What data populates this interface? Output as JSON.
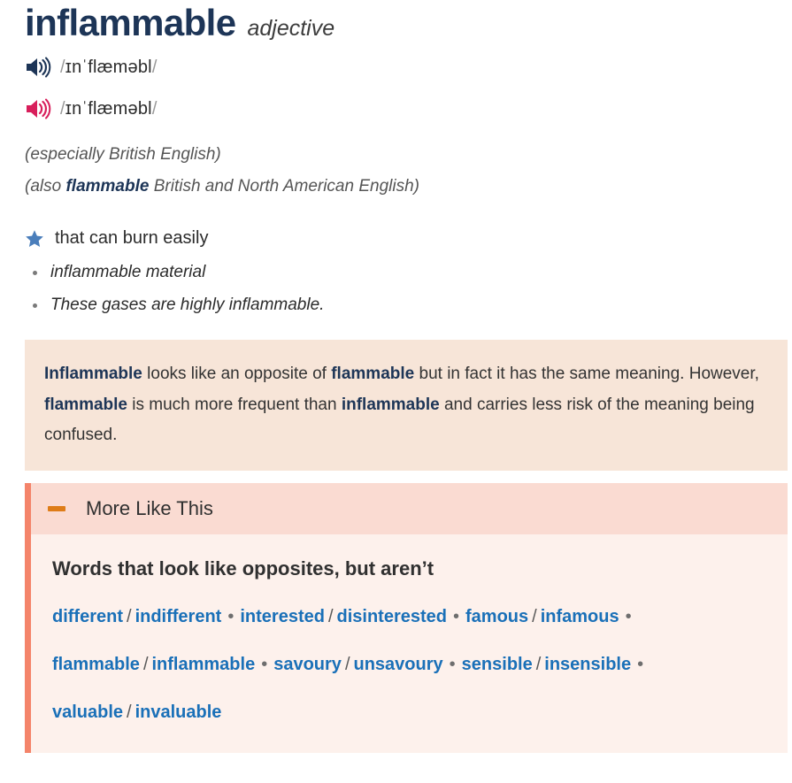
{
  "entry": {
    "headword": "inflammable",
    "part_of_speech": "adjective",
    "pronunciations": [
      {
        "accent": "british",
        "ipa": "ɪnˈflæməbl",
        "open_slash": "/",
        "close_slash": "/",
        "icon": "speaker-icon",
        "icon_color": "#1d3557"
      },
      {
        "accent": "american",
        "ipa": "ɪnˈflæməbl",
        "open_slash": "/",
        "close_slash": "/",
        "icon": "speaker-icon",
        "icon_color": "#d81e5b"
      }
    ],
    "variant_notes": [
      {
        "prefix": "(especially British English)",
        "alt_word": "",
        "suffix": ""
      },
      {
        "prefix": "(also ",
        "alt_word": "flammable",
        "suffix": " British and North American English)"
      }
    ],
    "sense": {
      "icon": "star-icon",
      "icon_color": "#4a7ebb",
      "definition": "that can burn easily",
      "examples": [
        "inflammable material",
        "These gases are highly inflammable."
      ]
    }
  },
  "usage_note": {
    "background": "#f7e5d8",
    "segments": [
      {
        "text": "Inflammable",
        "bold": true
      },
      {
        "text": " looks like an opposite of ",
        "bold": false
      },
      {
        "text": "flammable",
        "bold": true
      },
      {
        "text": " but in fact it has the same meaning. However, ",
        "bold": false
      },
      {
        "text": "flammable",
        "bold": true
      },
      {
        "text": " is much more frequent than ",
        "bold": false
      },
      {
        "text": "inflammable",
        "bold": true
      },
      {
        "text": " and carries less risk of the meaning being confused.",
        "bold": false
      }
    ]
  },
  "more_like_this": {
    "header_label": "More Like This",
    "toggle_icon": "minus-icon",
    "toggle_color": "#de7c18",
    "accent_color": "#f4846a",
    "header_background": "#fadbd2",
    "body_background": "#fdf1ec",
    "subtitle": "Words that look like opposites, but aren’t",
    "link_color": "#1a70b8",
    "separator_slash": "/",
    "separator_dot": "•",
    "rows": [
      {
        "pairs": [
          {
            "first": "different",
            "second": "indifferent"
          },
          {
            "first": "interested",
            "second": "disinterested"
          },
          {
            "first": "famous",
            "second": "infamous"
          }
        ],
        "trailing_dot": true
      },
      {
        "pairs": [
          {
            "first": "flammable",
            "second": "inflammable"
          },
          {
            "first": "savoury",
            "second": "unsavoury"
          },
          {
            "first": "sensible",
            "second": "insensible"
          }
        ],
        "trailing_dot": true
      },
      {
        "pairs": [
          {
            "first": "valuable",
            "second": "invaluable"
          }
        ],
        "trailing_dot": false
      }
    ]
  }
}
